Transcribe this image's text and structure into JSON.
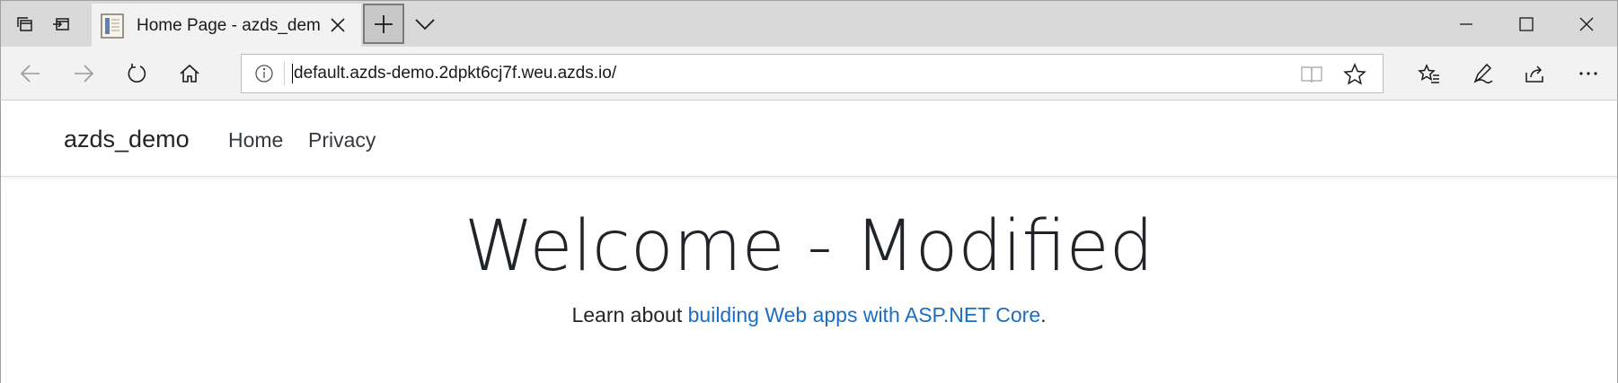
{
  "browser": {
    "tab": {
      "title": "Home Page - azds_dem"
    },
    "address_bar": {
      "url": "default.azds-demo.2dpkt6cj7f.weu.azds.io/"
    },
    "colors": {
      "titlebar_bg": "#d9d9d9",
      "toolbar_bg": "#f2f2f2",
      "link": "#1b6ec2"
    }
  },
  "site": {
    "brand": "azds_demo",
    "nav": [
      {
        "label": "Home"
      },
      {
        "label": "Privacy"
      }
    ],
    "heading": "Welcome - Modified",
    "lead": {
      "prefix": "Learn about ",
      "link_text": "building Web apps with ASP.NET Core",
      "suffix": "."
    }
  },
  "icons": {
    "titlebar": [
      "tab-groups-icon",
      "set-aside-tabs-icon",
      "page-favicon-icon",
      "close-icon",
      "plus-icon",
      "chevron-down-icon"
    ],
    "window": [
      "minimize-icon",
      "maximize-icon",
      "close-window-icon"
    ],
    "nav": [
      "back-arrow-icon",
      "forward-arrow-icon",
      "refresh-icon",
      "home-icon"
    ],
    "address": [
      "info-icon",
      "reading-view-icon",
      "star-icon"
    ],
    "toolbar": [
      "favorites-icon",
      "pen-icon",
      "share-icon",
      "more-icon"
    ]
  }
}
